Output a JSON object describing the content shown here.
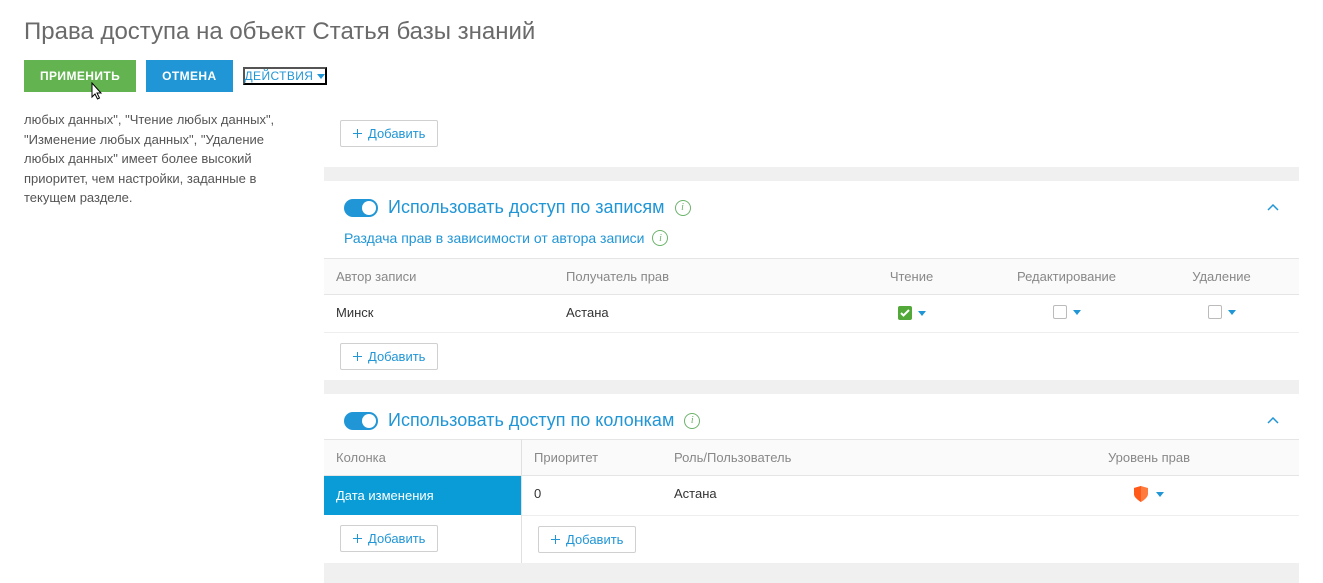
{
  "title": "Права доступа на объект Статья базы знаний",
  "toolbar": {
    "apply": "ПРИМЕНИТЬ",
    "cancel": "ОТМЕНА",
    "actions": "ДЕЙСТВИЯ"
  },
  "sidebar_text": "любых данных\", \"Чтение любых данных\", \"Изменение любых данных\", \"Удаление любых данных\" имеет более высокий приоритет, чем настройки, заданные в текущем разделе.",
  "add_label": "Добавить",
  "section_records": {
    "title": "Использовать доступ по записям",
    "subtitle": "Раздача прав в зависимости от автора записи",
    "columns": {
      "author": "Автор записи",
      "recipient": "Получатель прав",
      "read": "Чтение",
      "edit": "Редактирование",
      "delete": "Удаление"
    },
    "rows": [
      {
        "author": "Минск",
        "recipient": "Астана",
        "read": true,
        "edit": false,
        "delete": false
      }
    ]
  },
  "section_columns": {
    "title": "Использовать доступ по колонкам",
    "left_header": "Колонка",
    "left_rows": [
      "Дата изменения"
    ],
    "right_headers": {
      "priority": "Приоритет",
      "role": "Роль/Пользователь",
      "level": "Уровень прав"
    },
    "right_rows": [
      {
        "priority": "0",
        "role": "Астана"
      }
    ]
  }
}
